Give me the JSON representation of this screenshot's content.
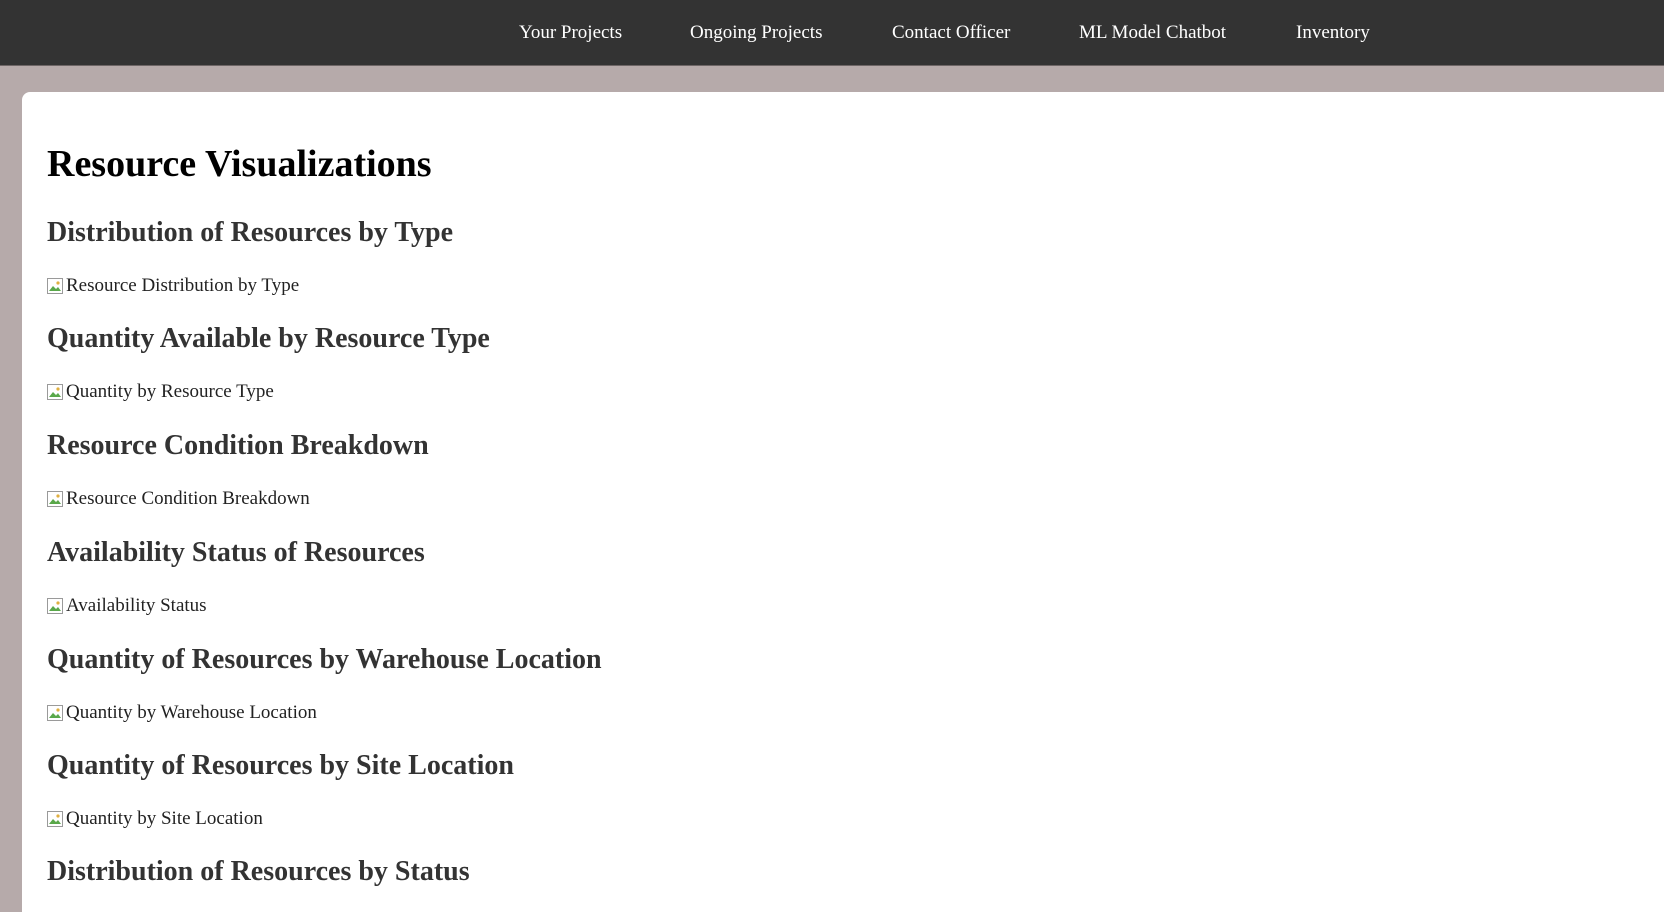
{
  "nav": {
    "items": [
      {
        "label": "Your Projects"
      },
      {
        "label": "Ongoing Projects"
      },
      {
        "label": "Contact Officer"
      },
      {
        "label": "ML Model Chatbot"
      },
      {
        "label": "Inventory"
      }
    ]
  },
  "page": {
    "title": "Resource Visualizations"
  },
  "sections": [
    {
      "heading": "Distribution of Resources by Type",
      "image_alt": "Resource Distribution by Type"
    },
    {
      "heading": "Quantity Available by Resource Type",
      "image_alt": "Quantity by Resource Type"
    },
    {
      "heading": "Resource Condition Breakdown",
      "image_alt": "Resource Condition Breakdown"
    },
    {
      "heading": "Availability Status of Resources",
      "image_alt": "Availability Status"
    },
    {
      "heading": "Quantity of Resources by Warehouse Location",
      "image_alt": "Quantity by Warehouse Location"
    },
    {
      "heading": "Quantity of Resources by Site Location",
      "image_alt": "Quantity by Site Location"
    },
    {
      "heading": "Distribution of Resources by Status",
      "image_alt": ""
    }
  ],
  "icons": {
    "broken_image": "broken-image-icon"
  },
  "colors": {
    "nav_background": "#333333",
    "page_background": "#b6aaaa",
    "panel_background": "#ffffff",
    "heading_text": "#333333"
  }
}
